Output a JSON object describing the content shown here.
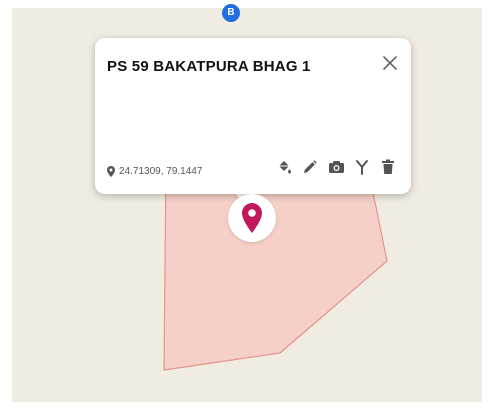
{
  "map": {
    "badge_label": "B",
    "polygon_fill": "#f6d0c8",
    "polygon_stroke": "#e3968c"
  },
  "popup": {
    "title": "PS 59 BAKATPURA BHAG 1",
    "coordinates": "24.71309, 79.1447",
    "close_icon": "close-icon",
    "tools": [
      {
        "name": "fill-color-button",
        "icon": "paint-bucket-icon"
      },
      {
        "name": "edit-button",
        "icon": "pencil-icon"
      },
      {
        "name": "add-photo-button",
        "icon": "camera-icon"
      },
      {
        "name": "connect-button",
        "icon": "fork-icon"
      },
      {
        "name": "delete-button",
        "icon": "trash-icon"
      }
    ]
  },
  "marker": {
    "icon": "map-pin-icon",
    "color": "#c2185b"
  }
}
